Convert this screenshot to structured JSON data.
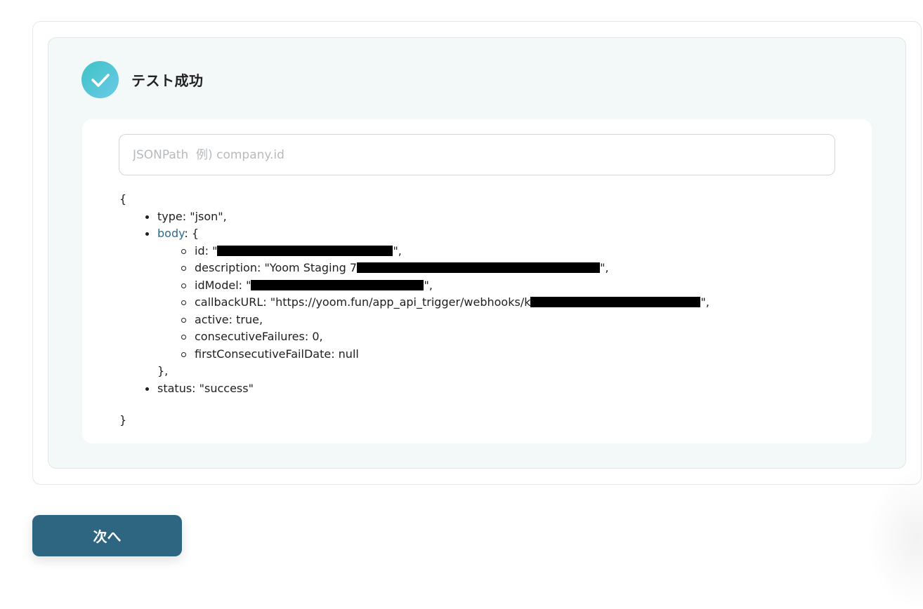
{
  "header": {
    "status_text": "テスト成功",
    "icon": "check-icon"
  },
  "jsonpath": {
    "placeholder": "JSONPath  例) company.id",
    "value": ""
  },
  "tree": {
    "open_brace": "{",
    "type_line": "type: \"json\",",
    "body_key": "body",
    "body_open": ": {",
    "id_prefix": "id: \"",
    "id_suffix": "\",",
    "description_prefix": "description: \"Yoom Staging 7",
    "description_suffix": "\",",
    "idmodel_prefix": "idModel: \"",
    "idmodel_suffix": "\",",
    "callback_prefix": "callbackURL: \"https://yoom.fun/app_api_trigger/webhooks/k",
    "callback_suffix": "\",",
    "active_line": "active: true,",
    "failures_line": "consecutiveFailures: 0,",
    "faildate_line": "firstConsecutiveFailDate: null",
    "body_close": "},",
    "status_line": "status: \"success\"",
    "close_brace": "}"
  },
  "footer": {
    "next_label": "次へ"
  },
  "colors": {
    "button": "#2e6681",
    "panel": "#f3f8f8",
    "link": "#2e6a8a",
    "accent": "#3dc3c5"
  }
}
